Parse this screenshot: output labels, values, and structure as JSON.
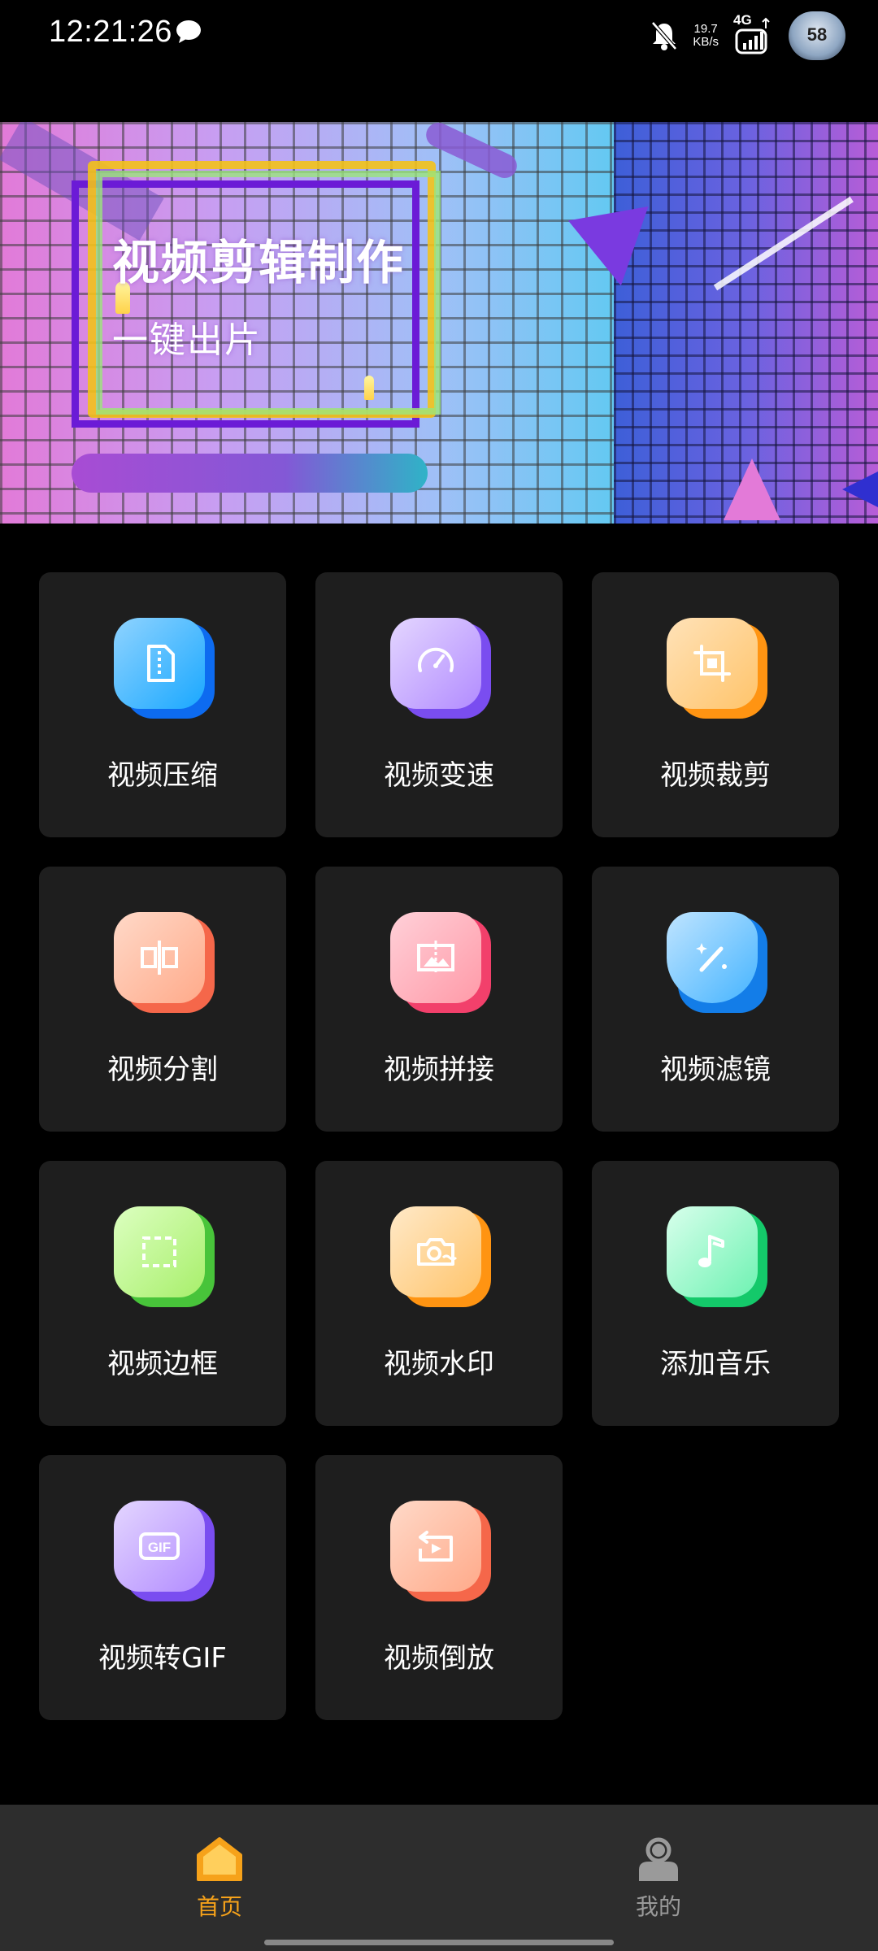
{
  "status_bar": {
    "time": "12:21:26",
    "speed_value": "19.7",
    "speed_unit": "KB/s",
    "network": "4G",
    "battery": "58"
  },
  "banner": {
    "title": "视频剪辑制作",
    "subtitle": "一键出片"
  },
  "tools": [
    {
      "label": "视频压缩",
      "icon": "compress-file-icon",
      "colors": [
        "#1aa8ff",
        "#0d6bf0"
      ]
    },
    {
      "label": "视频变速",
      "icon": "speedometer-icon",
      "colors": [
        "#b28cff",
        "#7a4df0"
      ]
    },
    {
      "label": "视频裁剪",
      "icon": "crop-icon",
      "colors": [
        "#ffc46b",
        "#ff9412"
      ]
    },
    {
      "label": "视频分割",
      "icon": "split-icon",
      "colors": [
        "#ffaa8a",
        "#f5674a"
      ]
    },
    {
      "label": "视频拼接",
      "icon": "stitch-image-icon",
      "colors": [
        "#ff9aa8",
        "#f2406b"
      ]
    },
    {
      "label": "视频滤镜",
      "icon": "magic-wand-shield-icon",
      "colors": [
        "#45b4ff",
        "#137de8"
      ]
    },
    {
      "label": "视频边框",
      "icon": "frame-border-icon",
      "colors": [
        "#a8ef6b",
        "#48c43a"
      ]
    },
    {
      "label": "视频水印",
      "icon": "camera-watermark-icon",
      "colors": [
        "#ffc46b",
        "#ff9412"
      ]
    },
    {
      "label": "添加音乐",
      "icon": "music-note-icon",
      "colors": [
        "#6ef2b2",
        "#14c96a"
      ]
    },
    {
      "label": "视频转GIF",
      "icon": "gif-icon",
      "colors": [
        "#b28cff",
        "#7a4df0"
      ]
    },
    {
      "label": "视频倒放",
      "icon": "reverse-play-icon",
      "colors": [
        "#ffaa8a",
        "#f5674a"
      ]
    }
  ],
  "nav": {
    "home_label": "首页",
    "mine_label": "我的",
    "active_color": "#f6a21a"
  }
}
